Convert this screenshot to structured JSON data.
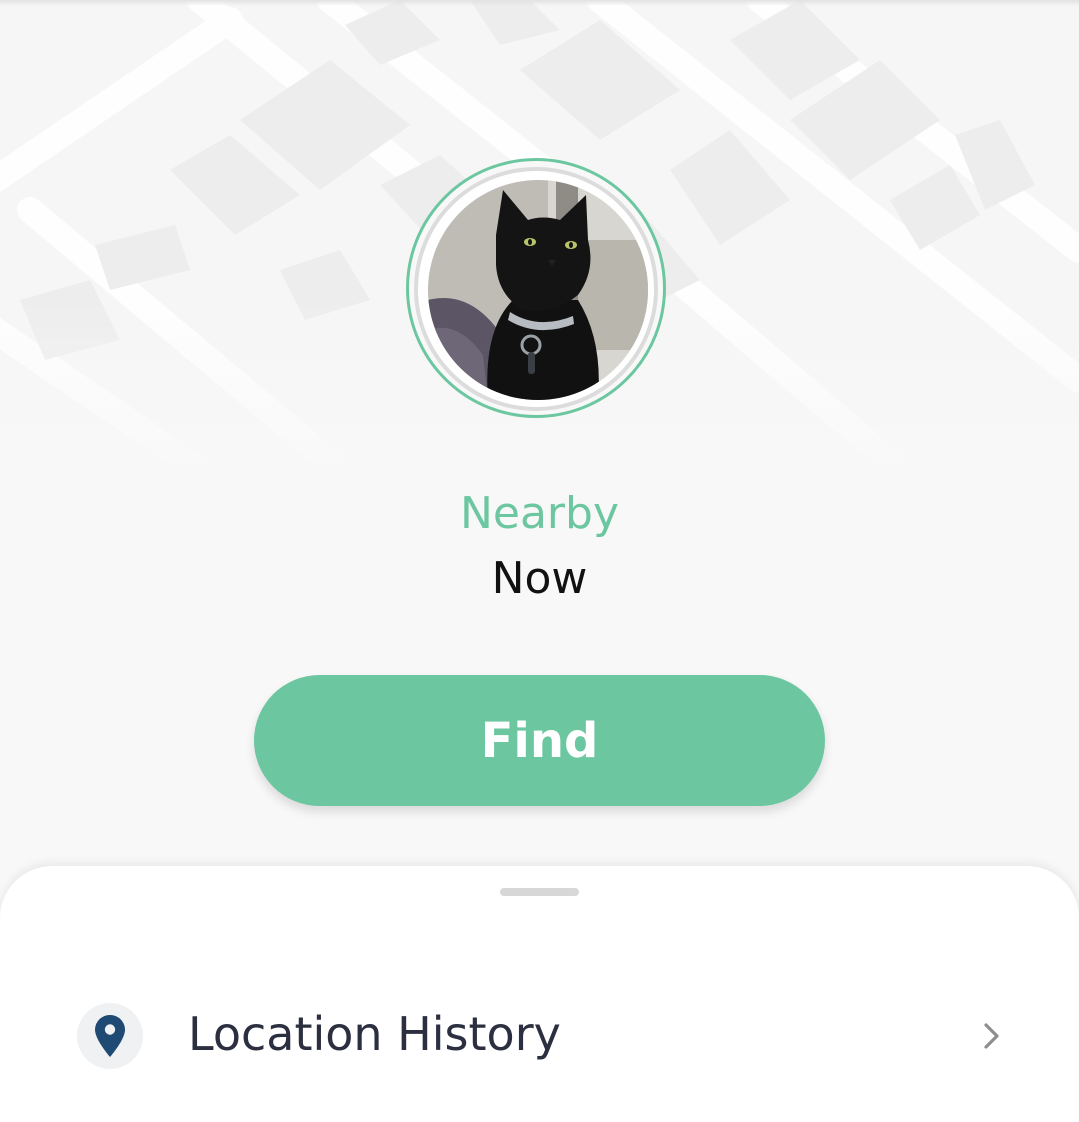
{
  "pet": {
    "status": "Nearby",
    "last_seen": "Now",
    "avatar_icon": "cat-photo"
  },
  "actions": {
    "find_label": "Find"
  },
  "sheet": {
    "items": [
      {
        "label": "Location History",
        "icon": "location-pin-icon"
      }
    ]
  },
  "colors": {
    "accent": "#6cc7a1",
    "pin": "#1e4a73",
    "text_dark": "#2b2f3f"
  }
}
